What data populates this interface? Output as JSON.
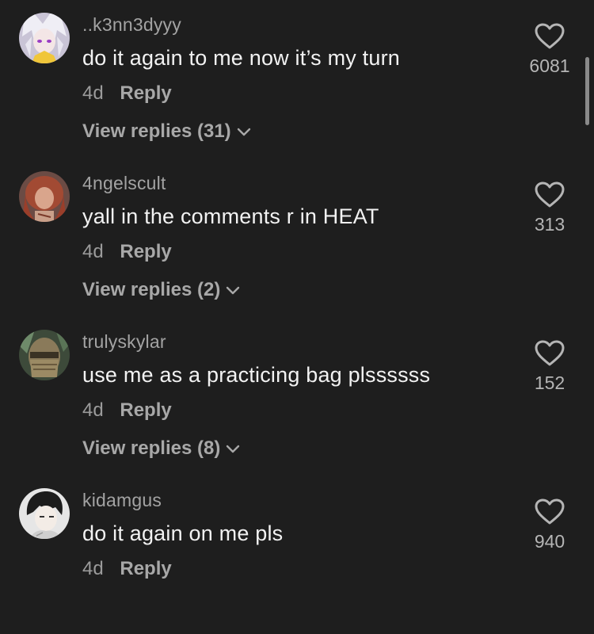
{
  "comments": [
    {
      "username": "..k3nn3dyyy",
      "text": "do it again to me now it’s my turn",
      "time": "4d",
      "reply_label": "Reply",
      "view_replies": "View replies (31)",
      "likes": "6081",
      "avatar_icon": "anime-girl-avatar"
    },
    {
      "username": "4ngelscult",
      "text": "yall in the comments r in HEAT",
      "time": "4d",
      "reply_label": "Reply",
      "view_replies": "View replies (2)",
      "likes": "313",
      "avatar_icon": "redhead-avatar"
    },
    {
      "username": "trulyskylar",
      "text": "use me as a practicing bag plssssss",
      "time": "4d",
      "reply_label": "Reply",
      "view_replies": "View replies (8)",
      "likes": "152",
      "avatar_icon": "masked-avatar"
    },
    {
      "username": "kidamgus",
      "text": "do it again on me pls",
      "time": "4d",
      "reply_label": "Reply",
      "likes": "940",
      "avatar_icon": "manhwa-boy-avatar"
    }
  ],
  "colors": {
    "background": "#1e1e1e",
    "username": "#a3a3a3",
    "text": "#f2f2f2",
    "meta": "#9b9b9b"
  }
}
